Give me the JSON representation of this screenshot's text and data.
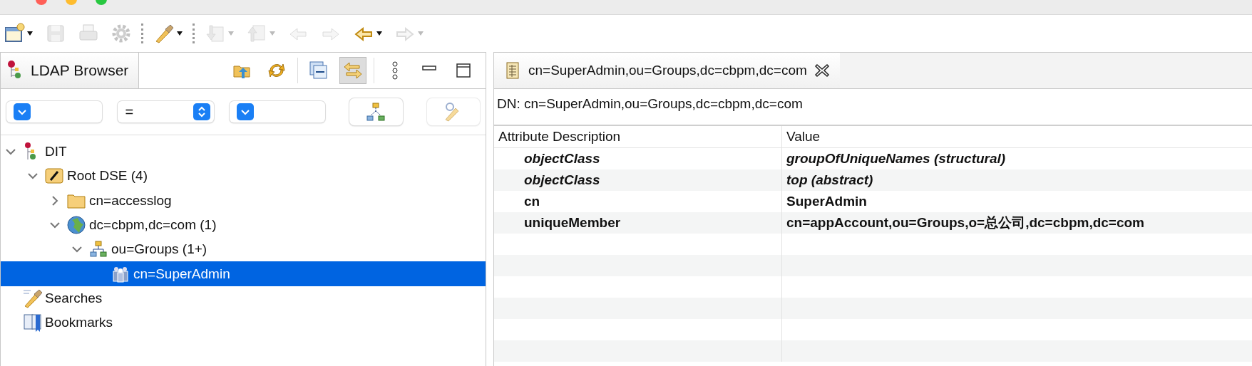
{
  "toolbar": [
    {
      "kind": "new",
      "disabled": false,
      "dropdown": true
    },
    {
      "kind": "save",
      "disabled": true,
      "dropdown": false
    },
    {
      "kind": "print",
      "disabled": true,
      "dropdown": false
    },
    {
      "kind": "gear",
      "disabled": true,
      "dropdown": false
    },
    {
      "kind": "separator"
    },
    {
      "kind": "search",
      "disabled": false,
      "dropdown": true
    },
    {
      "kind": "separator"
    },
    {
      "kind": "import",
      "disabled": true,
      "dropdown": true
    },
    {
      "kind": "export",
      "disabled": true,
      "dropdown": true
    },
    {
      "kind": "back-star",
      "disabled": true,
      "dropdown": false
    },
    {
      "kind": "forward-star",
      "disabled": true,
      "dropdown": false
    },
    {
      "kind": "back",
      "disabled": false,
      "dropdown": true
    },
    {
      "kind": "forward",
      "disabled": true,
      "dropdown": true
    }
  ],
  "browser": {
    "tab": {
      "label": "LDAP Browser",
      "selected": true
    },
    "view_actions": [
      {
        "kind": "folder-up",
        "pressed": false
      },
      {
        "kind": "refresh",
        "pressed": false
      },
      {
        "kind": "collapse",
        "pressed": false
      },
      {
        "kind": "link",
        "pressed": true
      },
      {
        "kind": "menu",
        "pressed": false
      },
      {
        "kind": "minimize",
        "pressed": false
      },
      {
        "kind": "maximize",
        "pressed": false
      }
    ],
    "filter": [
      {
        "kind": "combo"
      },
      {
        "kind": "stepper",
        "value": "="
      },
      {
        "kind": "combo"
      },
      {
        "kind": "tree-button",
        "disabled": false
      },
      {
        "kind": "search-button",
        "disabled": true
      }
    ],
    "tree": [
      {
        "label": "DIT",
        "kind": "dit",
        "expanded": true,
        "selected": false,
        "children": [
          {
            "label": "Root DSE (4)",
            "kind": "rootdse",
            "expanded": true,
            "selected": false,
            "children": [
              {
                "label": "cn=accesslog",
                "kind": "folder",
                "expanded": false,
                "selected": false,
                "has_children": true
              },
              {
                "label": "dc=cbpm,dc=com (1)",
                "kind": "globe",
                "expanded": true,
                "selected": false,
                "children": [
                  {
                    "label": "ou=Groups (1+)",
                    "kind": "ou",
                    "expanded": true,
                    "selected": false,
                    "children": [
                      {
                        "label": "cn=SuperAdmin",
                        "kind": "group",
                        "selected": true
                      }
                    ]
                  }
                ]
              }
            ]
          }
        ]
      },
      {
        "label": "Searches",
        "kind": "searches",
        "selected": false
      },
      {
        "label": "Bookmarks",
        "kind": "bookmarks",
        "selected": false
      }
    ]
  },
  "editor": {
    "tab": {
      "label": "cn=SuperAdmin,ou=Groups,dc=cbpm,dc=com",
      "selected": true
    },
    "dn": "DN: cn=SuperAdmin,ou=Groups,dc=cbpm,dc=com",
    "columns": [
      "Attribute Description",
      "Value"
    ],
    "rows": [
      {
        "attribute": "objectClass",
        "value": "groupOfUniqueNames (structural)",
        "kind": "objectclass"
      },
      {
        "attribute": "objectClass",
        "value": "top (abstract)",
        "kind": "objectclass"
      },
      {
        "attribute": "cn",
        "value": "SuperAdmin",
        "kind": "must"
      },
      {
        "attribute": "uniqueMember",
        "value": "cn=appAccount,ou=Groups,o=总公司,dc=cbpm,dc=com",
        "kind": "must"
      }
    ]
  }
}
